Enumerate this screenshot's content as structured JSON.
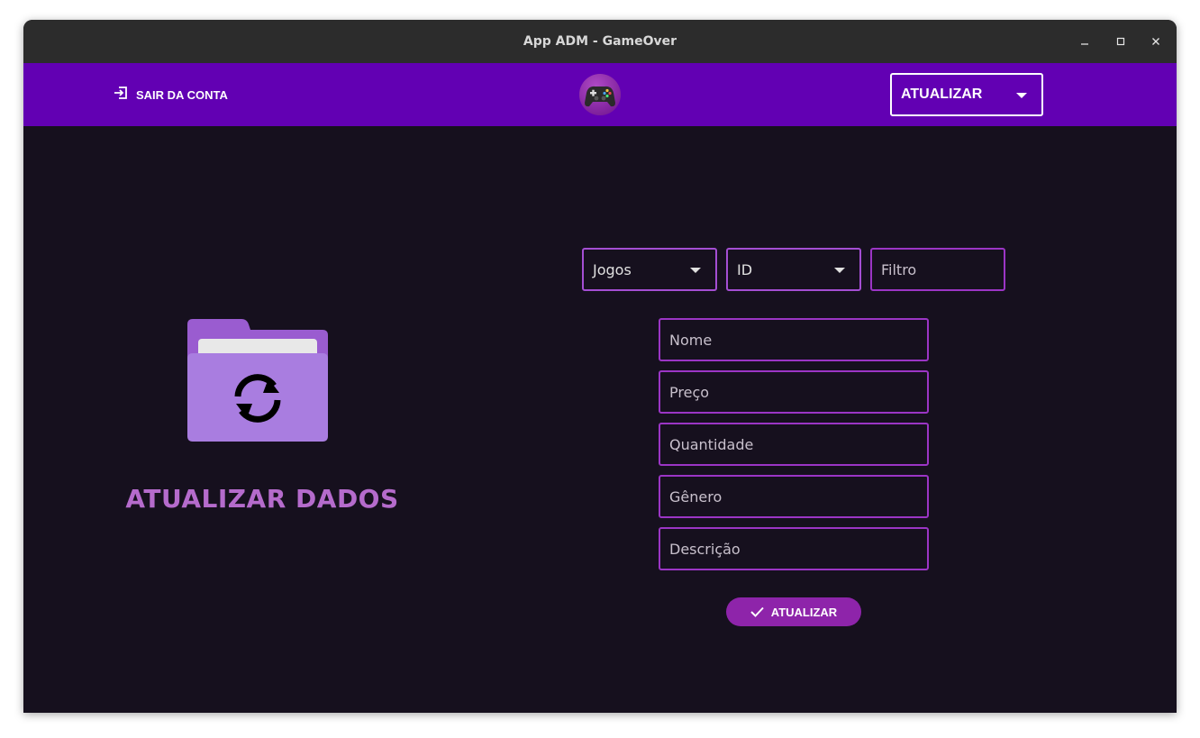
{
  "window": {
    "title": "App ADM - GameOver"
  },
  "appbar": {
    "logout_label": "SAIR DA CONTA",
    "mode_select": {
      "selected": "ATUALIZAR"
    }
  },
  "left_panel": {
    "title": "ATUALIZAR DADOS"
  },
  "filters": {
    "category": "Jogos",
    "field": "ID",
    "filter_placeholder": "Filtro"
  },
  "form": {
    "name_placeholder": "Nome",
    "price_placeholder": "Preço",
    "quantity_placeholder": "Quantidade",
    "genre_placeholder": "Gênero",
    "description_placeholder": "Descrição",
    "submit_label": "ATUALIZAR"
  },
  "colors": {
    "appbar": "#6200b3",
    "background": "#16101e",
    "accent": "#9b35c5",
    "title_text": "#b56bcc",
    "button": "#8e24aa"
  }
}
